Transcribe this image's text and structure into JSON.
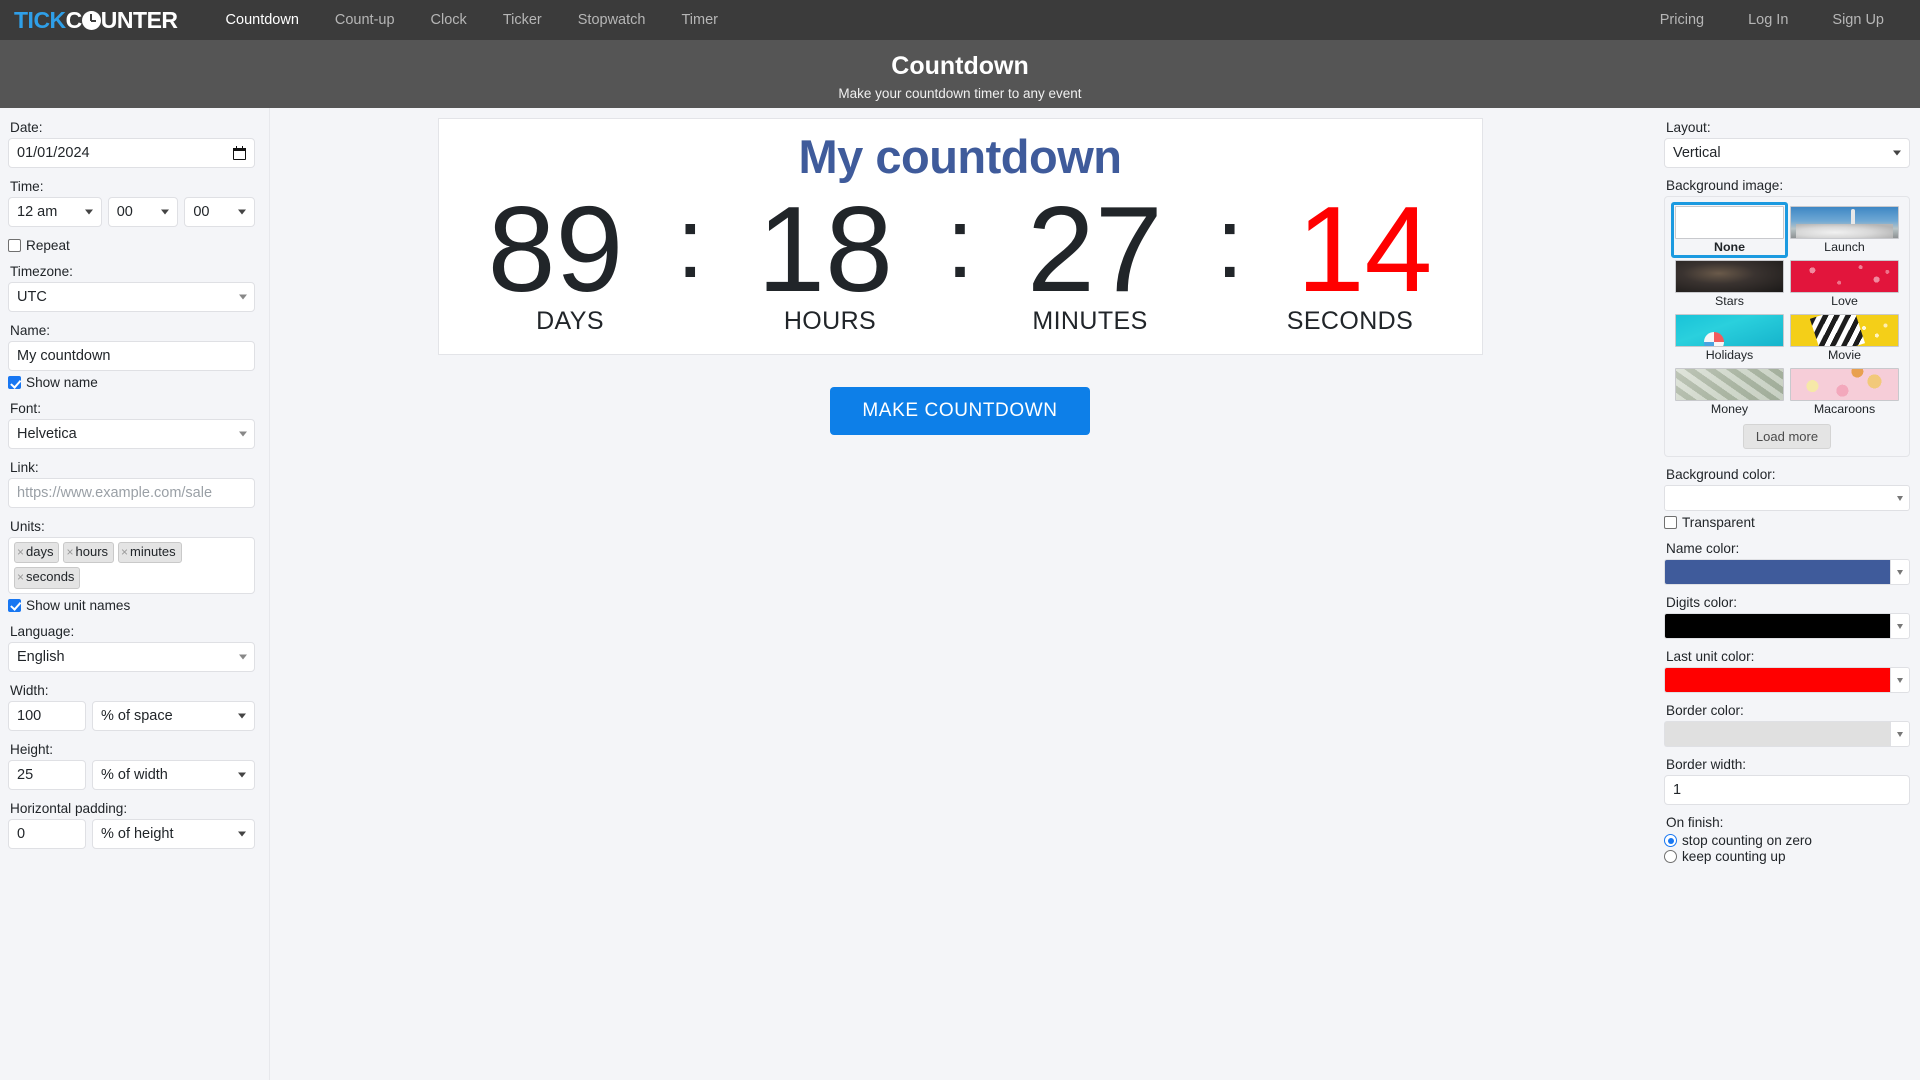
{
  "nav": {
    "logo": {
      "part1": "TICK",
      "part2a": "C",
      "part2b": "UNTER"
    },
    "links": [
      {
        "label": "Countdown",
        "active": true
      },
      {
        "label": "Count-up",
        "active": false
      },
      {
        "label": "Clock",
        "active": false
      },
      {
        "label": "Ticker",
        "active": false
      },
      {
        "label": "Stopwatch",
        "active": false
      },
      {
        "label": "Timer",
        "active": false
      }
    ],
    "right_links": [
      {
        "label": "Pricing"
      },
      {
        "label": "Log In"
      },
      {
        "label": "Sign Up"
      }
    ]
  },
  "page_header": {
    "title": "Countdown",
    "subtitle": "Make your countdown timer to any event"
  },
  "sidebar": {
    "date": {
      "label": "Date:",
      "value": "01/01/2024"
    },
    "time": {
      "label": "Time:",
      "hour": "12 am",
      "minute": "00",
      "second": "00"
    },
    "repeat": {
      "label": "Repeat",
      "checked": false
    },
    "timezone": {
      "label": "Timezone:",
      "value": "UTC"
    },
    "name": {
      "label": "Name:",
      "value": "My countdown"
    },
    "show_name": {
      "label": "Show name",
      "checked": true
    },
    "font": {
      "label": "Font:",
      "value": "Helvetica"
    },
    "link": {
      "label": "Link:",
      "value": "",
      "placeholder": "https://www.example.com/sale"
    },
    "units": {
      "label": "Units:",
      "tags": [
        "days",
        "hours",
        "minutes",
        "seconds"
      ],
      "remove_glyph": "×"
    },
    "show_unit_names": {
      "label": "Show unit names",
      "checked": true
    },
    "language": {
      "label": "Language:",
      "value": "English"
    },
    "width": {
      "label": "Width:",
      "value": "100",
      "unit": "% of space"
    },
    "height": {
      "label": "Height:",
      "value": "25",
      "unit": "% of width"
    },
    "horizontal_padding": {
      "label": "Horizontal padding:",
      "value": "0",
      "unit": "% of height"
    }
  },
  "preview": {
    "name": "My countdown",
    "name_color": "#3f5b9b",
    "digits_color": "#000000",
    "last_unit_color": "#ff0000",
    "separator": ":",
    "units": [
      {
        "value": "89",
        "label": "DAYS",
        "last": false
      },
      {
        "value": "18",
        "label": "HOURS",
        "last": false
      },
      {
        "value": "27",
        "label": "MINUTES",
        "last": false
      },
      {
        "value": "14",
        "label": "SECONDS",
        "last": true
      }
    ],
    "make_button": "MAKE COUNTDOWN"
  },
  "rightbar": {
    "layout": {
      "label": "Layout:",
      "value": "Vertical"
    },
    "background_image": {
      "label": "Background image:",
      "items": [
        {
          "caption": "None",
          "selected": true,
          "thumb": "none-thumb"
        },
        {
          "caption": "Launch",
          "selected": false,
          "thumb": "launch-thumb"
        },
        {
          "caption": "Stars",
          "selected": false,
          "thumb": "stars-thumb"
        },
        {
          "caption": "Love",
          "selected": false,
          "thumb": "love-thumb"
        },
        {
          "caption": "Holidays",
          "selected": false,
          "thumb": "holidays-thumb"
        },
        {
          "caption": "Movie",
          "selected": false,
          "thumb": "movie-thumb"
        },
        {
          "caption": "Money",
          "selected": false,
          "thumb": "money-thumb"
        },
        {
          "caption": "Macaroons",
          "selected": false,
          "thumb": "macaroons-thumb"
        }
      ],
      "load_more": "Load more"
    },
    "background_color": {
      "label": "Background color:",
      "value": "#ffffff"
    },
    "transparent": {
      "label": "Transparent",
      "checked": false
    },
    "name_color": {
      "label": "Name color:",
      "value": "#3f5b9b"
    },
    "digits_color": {
      "label": "Digits color:",
      "value": "#000000"
    },
    "last_unit_color": {
      "label": "Last unit color:",
      "value": "#ff0000"
    },
    "border_color": {
      "label": "Border color:",
      "value": "#e0e0e0"
    },
    "border_width": {
      "label": "Border width:",
      "value": "1"
    },
    "on_finish": {
      "label": "On finish:",
      "options": [
        {
          "label": "stop counting on zero",
          "selected": true
        },
        {
          "label": "keep counting up",
          "selected": false
        }
      ]
    }
  }
}
